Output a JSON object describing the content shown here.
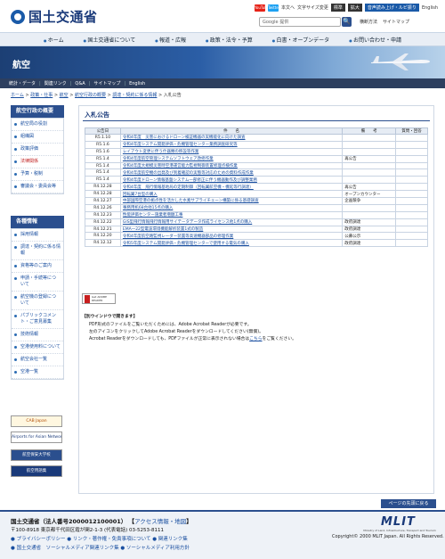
{
  "header": {
    "logo_text": "国土交通省",
    "sns": [
      {
        "name": "YouTube",
        "color": "#e62117"
      },
      {
        "name": "Twitter",
        "color": "#1da1f2"
      }
    ],
    "links": [
      "本文へ",
      "文字サイズ変更"
    ],
    "size_buttons": [
      "標準",
      "拡大"
    ],
    "voice_button": "音声読み上げ・ルビ振り",
    "english": "English",
    "search_placeholder": "Google 提供",
    "search_label": "🔍",
    "sub_links": [
      "横断方法",
      "サイトマップ"
    ]
  },
  "gnav": [
    "ホーム",
    "国土交通省について",
    "報道・広報",
    "政策・法令・予算",
    "白書・オープンデータ",
    "お問い合わせ・申請"
  ],
  "banner": {
    "title": "航空"
  },
  "ganav": [
    "統計・データ",
    "関連リンク",
    "Q&A",
    "サイトマップ",
    "English"
  ],
  "breadcrumb": {
    "items": [
      "ホーム",
      "政策・仕事",
      "航空",
      "航空行政の概要",
      "調達・契約に係る情報"
    ],
    "current": "入札公告"
  },
  "sidebar": {
    "section1_title": "航空行政の概要",
    "section1_items": [
      "航空局の役割",
      "組織図",
      "政策評価",
      "法律関係",
      "予算・税制",
      "審議会・委員会等"
    ],
    "section1_active": 3,
    "section2_title": "各種情報",
    "section2_items": [
      "採用情報",
      "調達・契約に係る情報",
      "資格等のご案内",
      "申請・手続等について",
      "航空機の登録について",
      "パブリックコメント・ご意見募集",
      "技術情報",
      "空港使用料について",
      "航空会社一覧",
      "空港一覧"
    ],
    "banners": [
      "CAB Japan",
      "Airports for Asian Network",
      "航空保安大学校",
      "航空用語集"
    ]
  },
  "main": {
    "title": "入札公告",
    "table": {
      "headers": [
        "公告日",
        "件　　名",
        "備　　考",
        "質問・回答"
      ],
      "rows": [
        {
          "date": "R5.1.10",
          "name": "令和4年度　災害におけるドローン検証機器の実機能化に向けた調査",
          "note": "",
          "qa": ""
        },
        {
          "date": "R5.1.6",
          "name": "令和4年度システム開発評価・危機管理センター業務調査研究等",
          "note": "",
          "qa": ""
        },
        {
          "date": "R5.1.6",
          "name": "レイアウト変更に伴う什器類の移設等作業",
          "note": "",
          "qa": ""
        },
        {
          "date": "R5.1.4",
          "name": "令和4年度航空管理システムソフトウェア改修作業",
          "note": "再公告",
          "qa": ""
        },
        {
          "date": "R5.1.4",
          "name": "令和4年度大規模災害時空港運営能力監視制御装置修理点検作業",
          "note": "",
          "qa": ""
        },
        {
          "date": "R5.1.4",
          "name": "令和4年度航空機の出発及び到着確認の実態等対応のための資料作成作業",
          "note": "",
          "qa": ""
        },
        {
          "date": "R5.1.4",
          "name": "令和4年度ドローン情報基盤システム一部修正に伴う機器動作及び調整業務",
          "note": "",
          "qa": ""
        },
        {
          "date": "R4.12.28",
          "name": "令和4年度　飛行情報基地局の定期制御（回転翼航空機・機延等行調達）",
          "note": "再公告",
          "qa": ""
        },
        {
          "date": "R4.12.28",
          "name": "回転翼7台型の購入",
          "note": "オープンカウンター",
          "qa": ""
        },
        {
          "date": "R4.12.27",
          "name": "中部国際空港の拠点性を活かした水素サプライチェーン構築に係る基礎調査",
          "note": "企画競争",
          "qa": ""
        },
        {
          "date": "R4.12.26",
          "name": "事務用机68台他15点の購入",
          "note": "",
          "qa": ""
        },
        {
          "date": "R4.12.23",
          "name": "性能評価センター施業者増額工事",
          "note": "",
          "qa": ""
        },
        {
          "date": "R4.12.22",
          "name": "GIS型飛行情報飛行情報用サイテータデータ作成ライセンス他1点の購入",
          "note": "政府調達",
          "qa": ""
        },
        {
          "date": "R4.12.21",
          "name": "EMA一22型電波環境機能解析装置1式の製造",
          "note": "政府調達",
          "qa": ""
        },
        {
          "date": "R4.12.20",
          "name": "令和4年度航空路監視レーダー装置等高速機器部品の修理作業",
          "note": "公募公示",
          "qa": ""
        },
        {
          "date": "R4.12.12",
          "name": "令和5年度システム開発評価・危機管理センターで使用する電気の購入",
          "note": "政府調達",
          "qa": ""
        }
      ]
    },
    "pdf_badge_text": "Get ADOBE READER",
    "pdf_note_title": "【別ウインドウで開きます】",
    "pdf_lines": [
      "PDF形式のファイルをご覧いただくためには、Adobe Acrobat Readerが必要です。",
      "左のアイコンをクリックしてAdobe Acrobat Readerをダウンロードしてください(無償)。",
      "Acrobat Readerをダウンロードしても、PDFファイルが正常に表示されない場合は"
    ],
    "pdf_link": "こちら",
    "pdf_tail": "をご覧ください。"
  },
  "footer": {
    "pagetop": "ページの先頭に戻る",
    "org": "国土交通省（法人番号2000012100001）",
    "access_link": "アクセス情報・地図",
    "address": "〒100-8918 東京都千代田区霞が関2-1-3 (代表電話) 03-5253-8111",
    "links_row1": [
      "プライバシーポリシー",
      "リンク・著作権・免責事項について",
      "関連リンク集"
    ],
    "links_row2": [
      "国土交通省　ソーシャルメディア関連リンク集",
      "ソーシャルメディア利用方針"
    ],
    "mlit": "MLIT",
    "mlit_sub": "Ministry of Land, Infrastructure, Transport and Tourism",
    "copyright": "Copyright© 2000 MLIT Japan. All Rights Reserved."
  }
}
